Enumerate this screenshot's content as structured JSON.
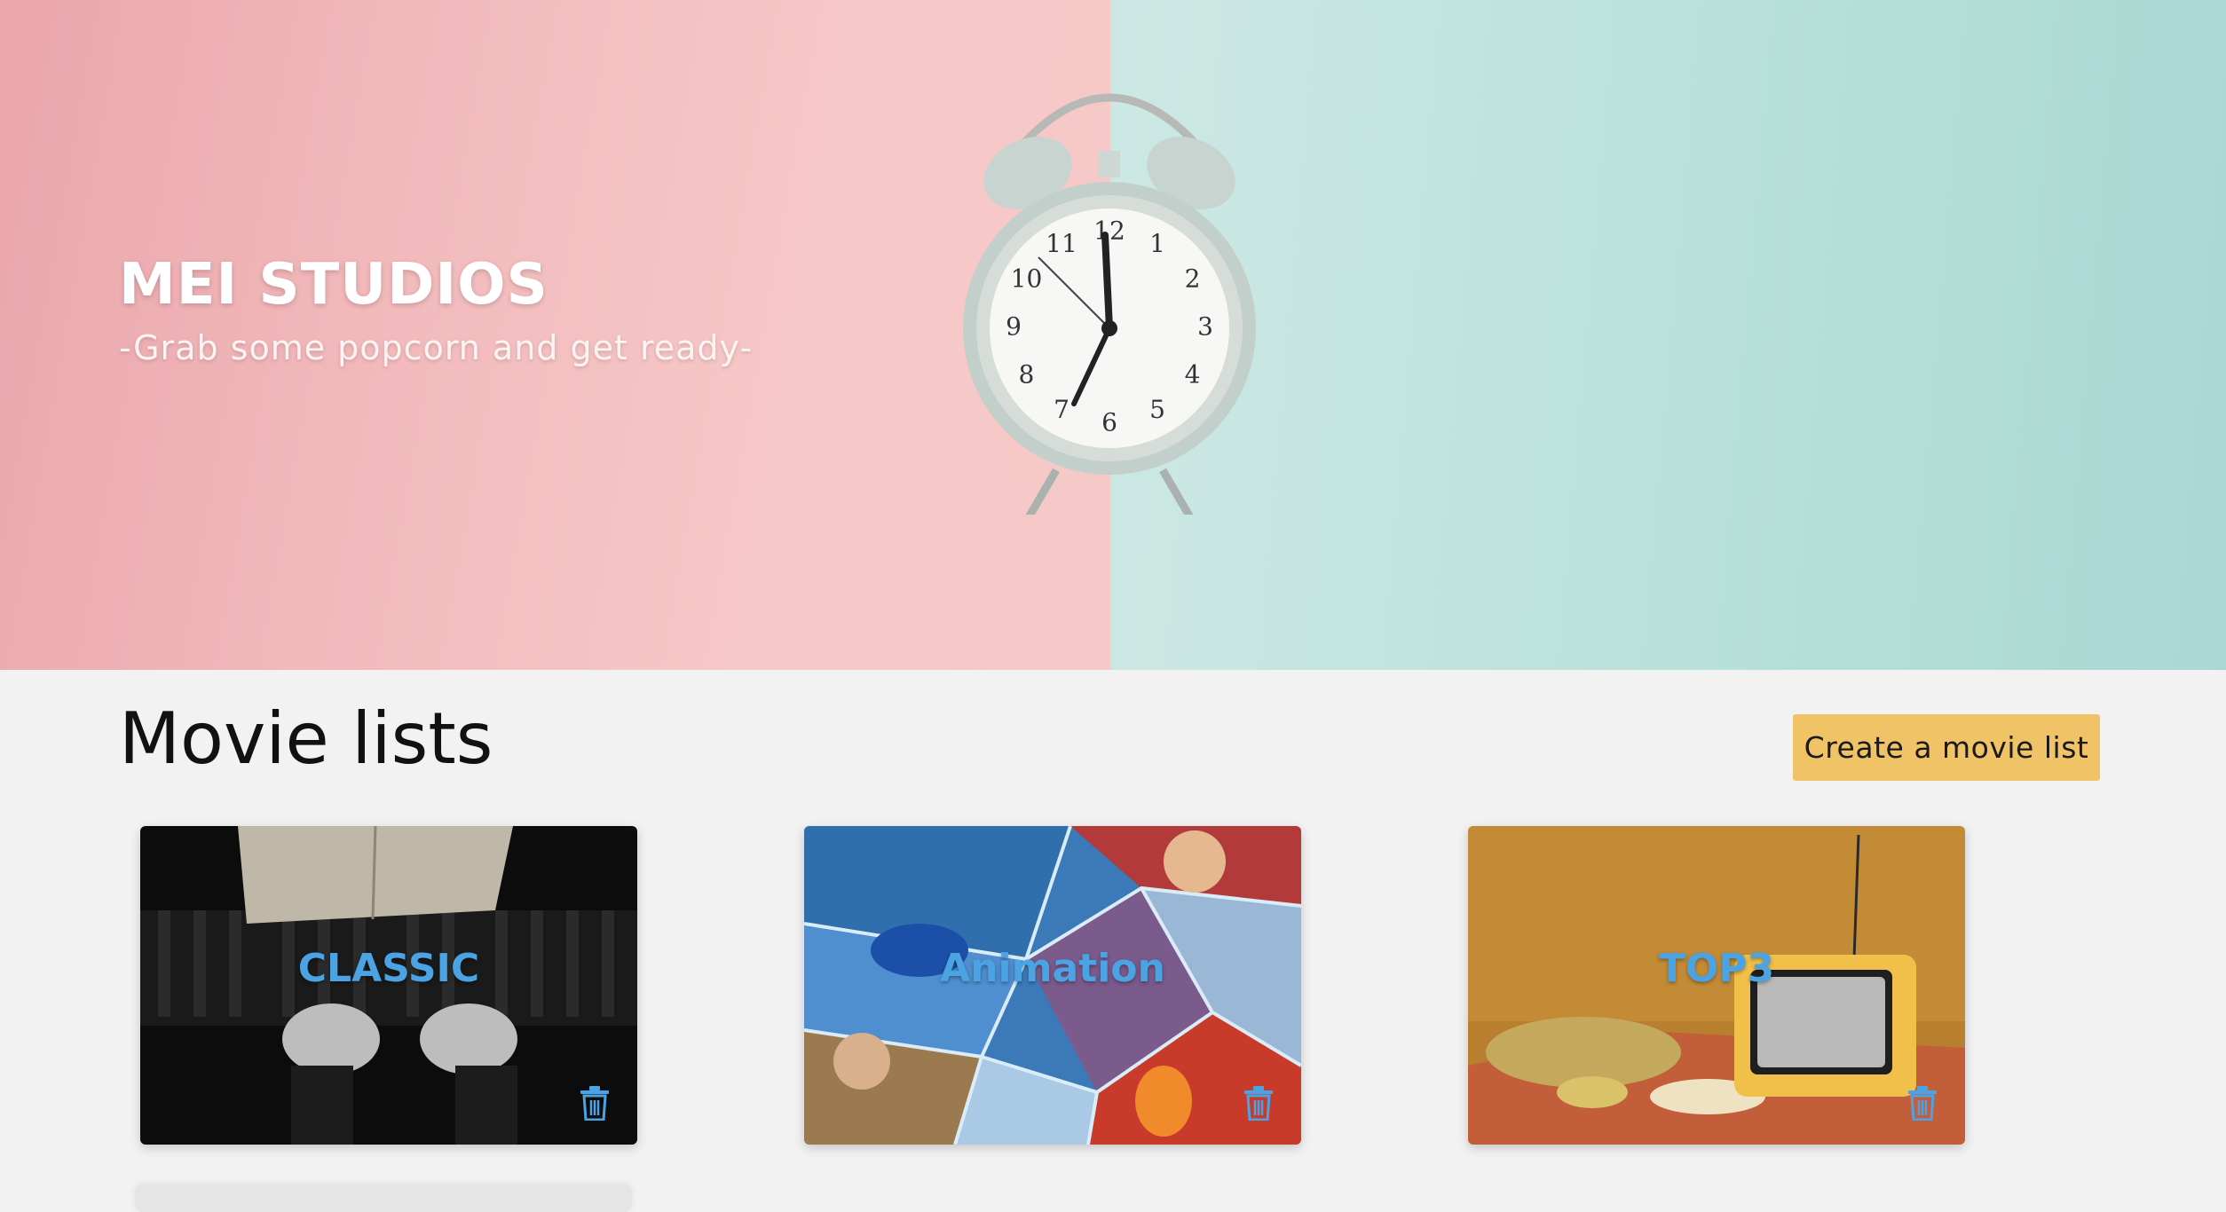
{
  "hero": {
    "title": "MEI STUDIOS",
    "subtitle": "-Grab some popcorn and get ready-"
  },
  "clock_numerals": [
    "12",
    "1",
    "2",
    "3",
    "4",
    "5",
    "6",
    "7",
    "8",
    "9",
    "10",
    "11"
  ],
  "movie_lists": {
    "heading": "Movie lists",
    "create_button": "Create a movie list",
    "cards": [
      {
        "title": "CLASSIC"
      },
      {
        "title": "Animation"
      },
      {
        "title": "TOP3"
      }
    ]
  },
  "colors": {
    "accent_button": "#f0c466",
    "card_title": "#4ba3e3",
    "hero_left": "#f2b9bb",
    "hero_right": "#b9e0da"
  },
  "icons": {
    "delete": "trash-icon"
  }
}
